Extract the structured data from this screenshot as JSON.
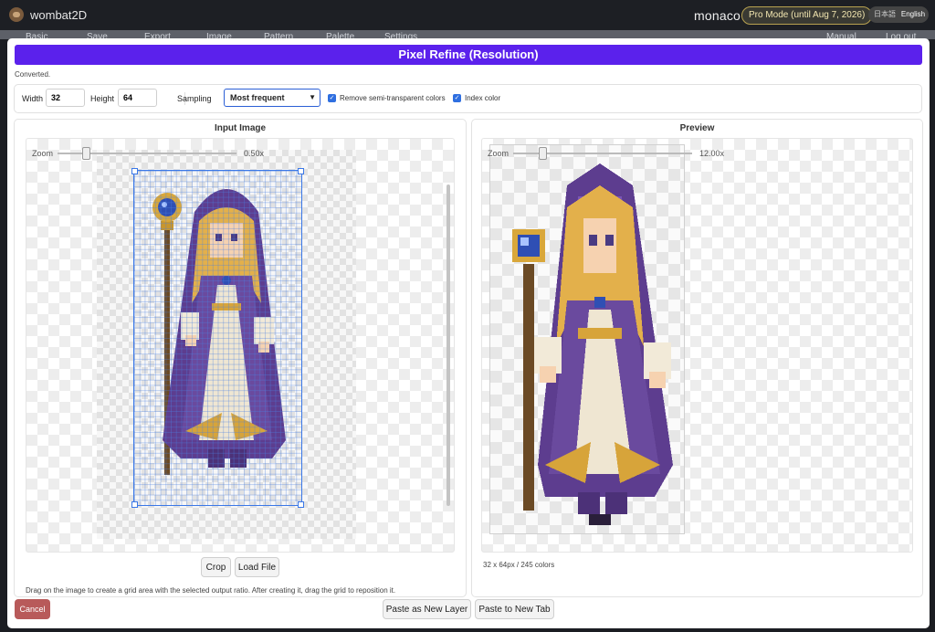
{
  "app": {
    "title": "wombat2D",
    "project": "monaco",
    "pro_badge": "Pro Mode (until Aug 7, 2026)",
    "lang_ja": "日本語",
    "lang_en": "English"
  },
  "menubar": [
    "Basic",
    "Save",
    "Export",
    "Image",
    "Pattern",
    "Palette",
    "Settings",
    "Manual",
    "Log out"
  ],
  "dialog": {
    "title": "Pixel Refine (Resolution)",
    "status": "Converted.",
    "width_label": "Width",
    "width_value": "32",
    "height_label": "Height",
    "height_value": "64",
    "sampling_label": "Sampling",
    "sampling_value": "Most frequent",
    "remove_semi_label": "Remove semi-transparent colors",
    "index_color_label": "Index color",
    "input_title": "Input Image",
    "preview_title": "Preview",
    "zoom_label": "Zoom",
    "input_zoom": "0.50x",
    "preview_zoom": "12.00x",
    "crop_label": "Crop",
    "load_file_label": "Load File",
    "hint": "Drag on the image to create a grid area with the selected output ratio. After creating it, drag the grid to reposition it.",
    "result_info": "32 x 64px / 245 colors",
    "cancel_label": "Cancel",
    "paste_layer_label": "Paste as New Layer",
    "paste_tab_label": "Paste to New Tab"
  },
  "colors": {
    "accent": "#5b21ec",
    "cancel": "#b85a5a",
    "checkbox": "#2f6fe0"
  },
  "icons": {
    "logo": "wombat-icon",
    "checkbox": "check-icon",
    "select": "chevron-down-icon"
  }
}
